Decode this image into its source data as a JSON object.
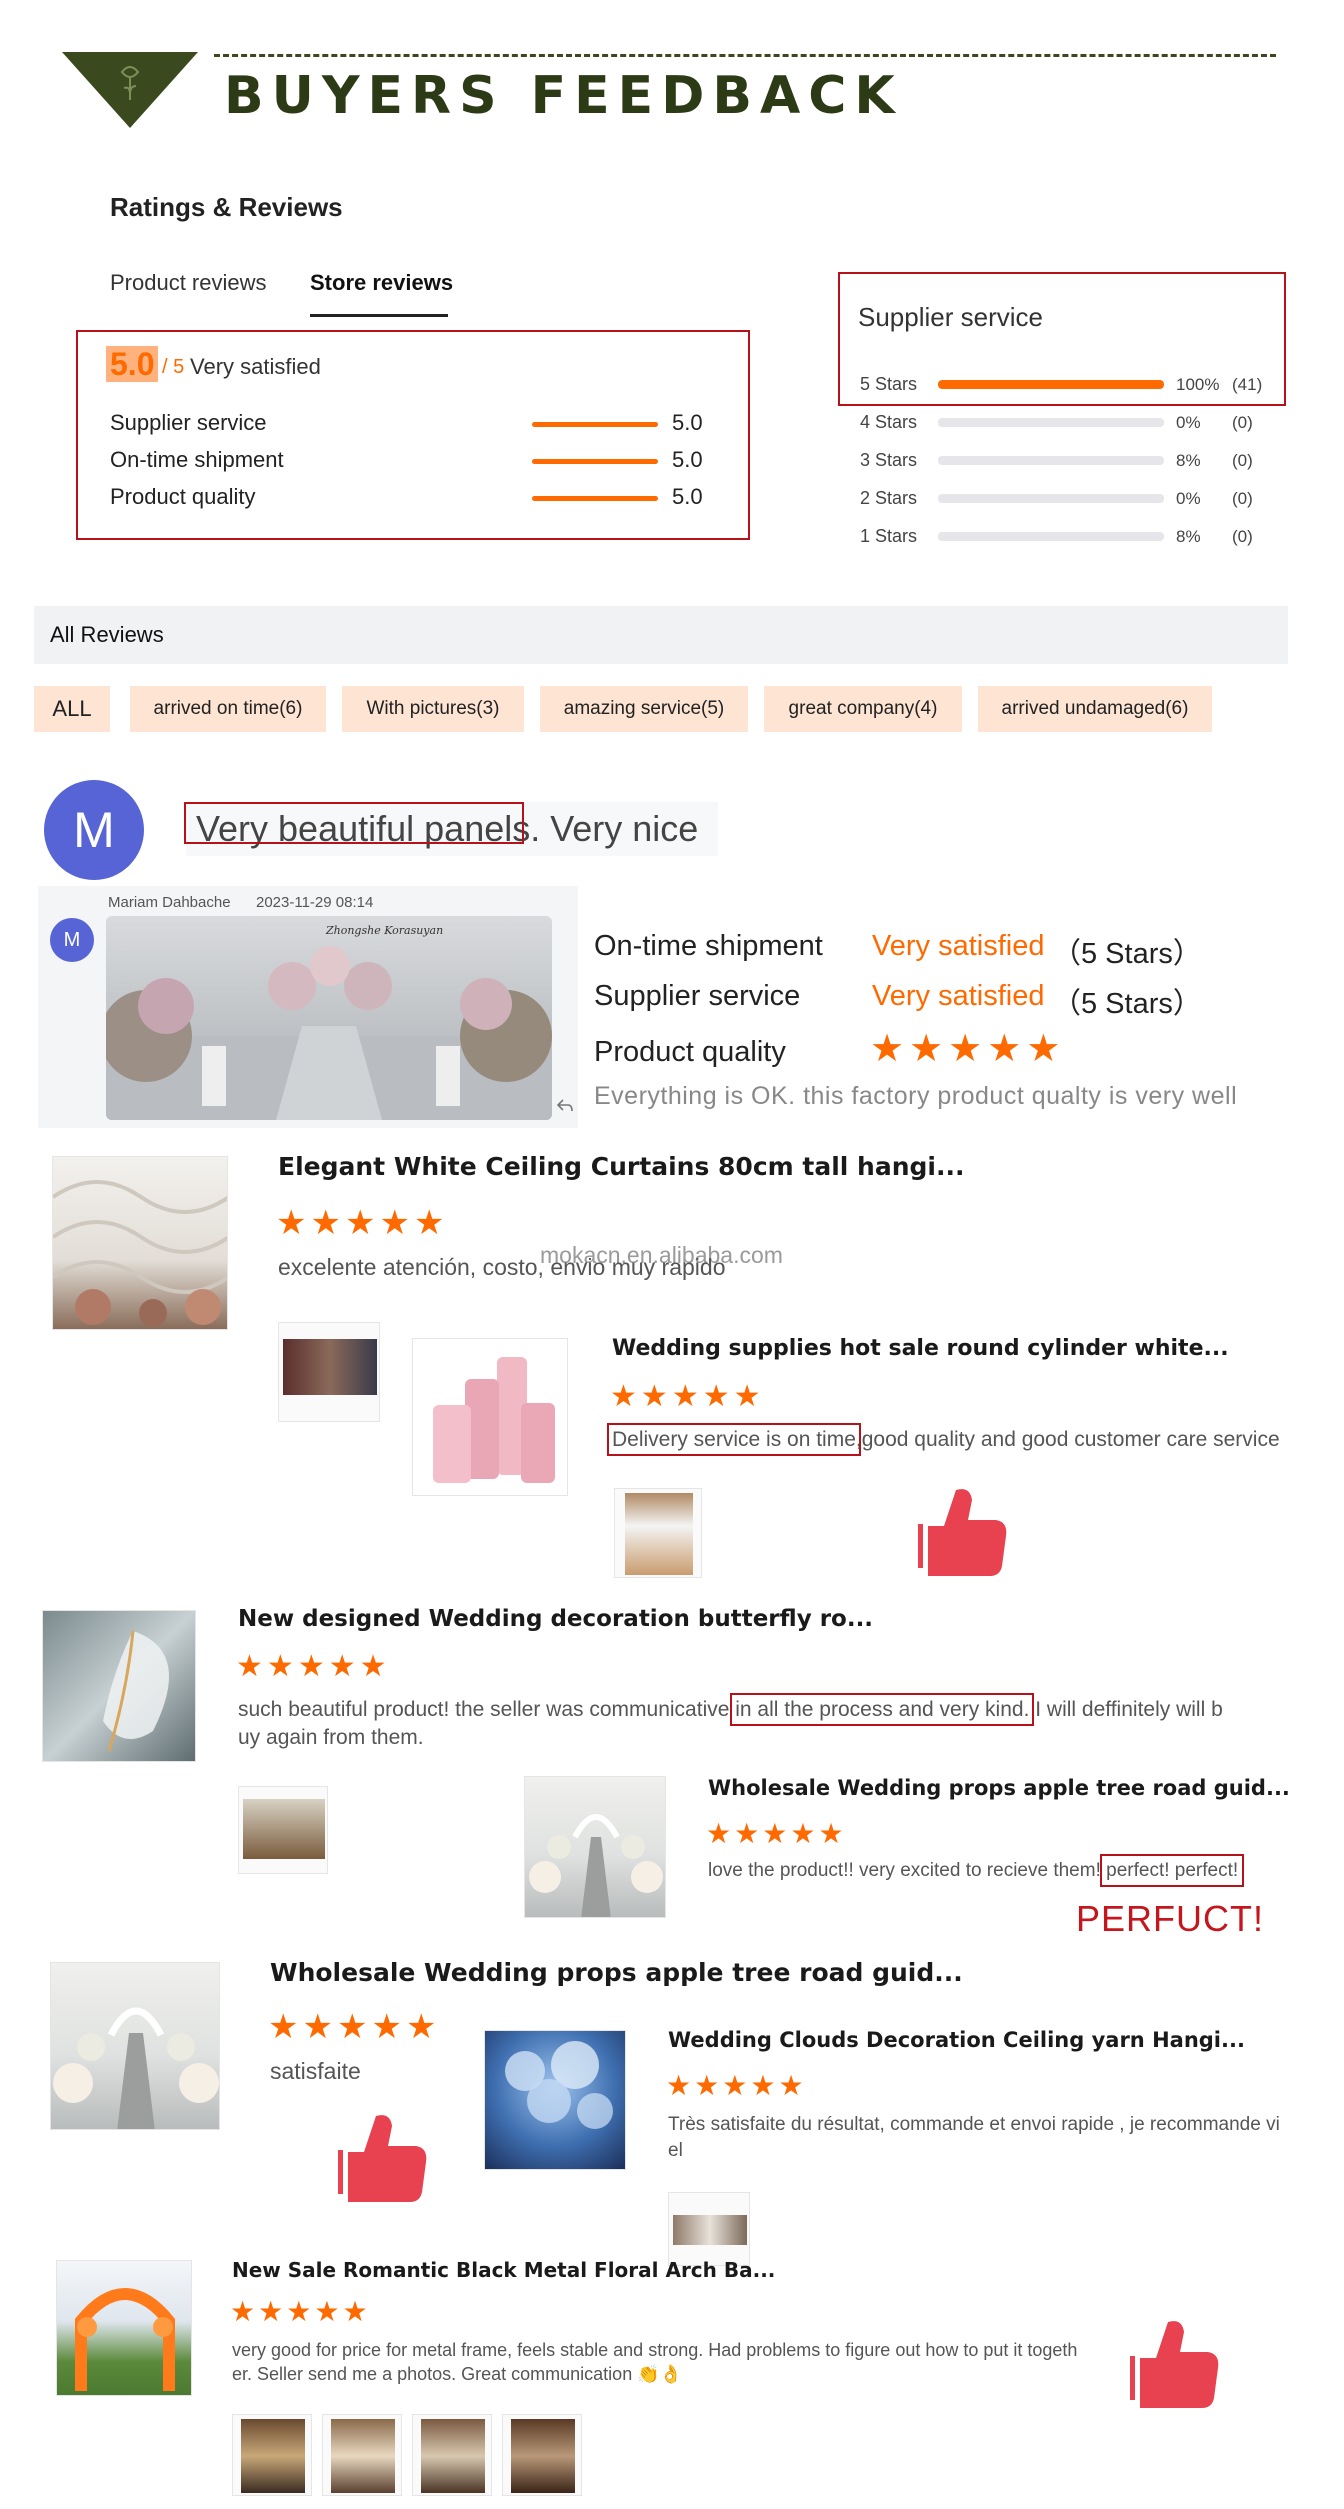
{
  "banner": {
    "title": "BUYERS FEEDBACK"
  },
  "ratings": {
    "heading": "Ratings & Reviews",
    "tabs": [
      "Product reviews",
      "Store reviews"
    ],
    "score": "5.0",
    "score_max": "/ 5",
    "score_label": "Very satisfied",
    "metrics": [
      {
        "label": "Supplier service",
        "value": "5.0",
        "fill": 1.0
      },
      {
        "label": "On-time shipment",
        "value": "5.0",
        "fill": 1.0
      },
      {
        "label": "Product quality",
        "value": "5.0",
        "fill": 1.0
      }
    ],
    "supplier": {
      "title": "Supplier service",
      "rows": [
        {
          "label": "5 Stars",
          "pct": "100%",
          "count": "(41)",
          "fill": 1.0
        },
        {
          "label": "4 Stars",
          "pct": "0%",
          "count": "(0)",
          "fill": 0.0
        },
        {
          "label": "3 Stars",
          "pct": "8%",
          "count": "(0)",
          "fill": 0.0
        },
        {
          "label": "2 Stars",
          "pct": "0%",
          "count": "(0)",
          "fill": 0.0
        },
        {
          "label": "1 Stars",
          "pct": "8%",
          "count": "(0)",
          "fill": 0.0
        }
      ]
    }
  },
  "all_reviews": {
    "heading": "All Reviews",
    "filters": [
      "ALL",
      "arrived on time(6)",
      "With pictures(3)",
      "amazing service(5)",
      "great company(4)",
      "arrived undamaged(6)"
    ]
  },
  "review1": {
    "avatar_letter": "M",
    "headline_highlight": "Very beautiful panels",
    "headline_rest": ". Very nice",
    "reviewer": "Mariam Dahbache",
    "date": "2023-11-29 08:14",
    "mini_avatar": "M",
    "mini_photo_caption": "Zhongshe Korasuyan",
    "ratings": [
      {
        "label": "On-time shipment",
        "value": "Very satisfied",
        "stars": "（5 Stars）"
      },
      {
        "label": "Supplier service",
        "value": "Very satisfied",
        "stars": "（5 Stars）"
      },
      {
        "label": "Product quality",
        "stars_count": 5
      }
    ],
    "comment": "Everything is OK. this factory product qualty is very well"
  },
  "watermark": "mokacn.en.alibaba.com",
  "products": [
    {
      "title": "Elegant White Ceiling Curtains 80cm tall hangi...",
      "stars": 5,
      "comment": "excelente atención, costo, envio muy rapido"
    },
    {
      "title": "Wedding supplies hot sale round cylinder white...",
      "stars": 5,
      "comment_highlight": "Delivery service is on time",
      "comment_rest": ",good quality and good customer care service"
    },
    {
      "title": "New designed Wedding decoration butterfly ro...",
      "stars": 5,
      "comment_a": "such beautiful product! the seller was communicative ",
      "comment_highlight": "in all the process and very kind.",
      "comment_b": " I will deffinitely will b",
      "comment_line2": "uy again from them."
    },
    {
      "title": "Wholesale Wedding props apple tree road guid...",
      "stars": 5,
      "comment_a": "love the product!! very excited to recieve them! ",
      "comment_highlight": "perfect! perfect!"
    },
    {
      "title": "Wholesale Wedding props apple tree road guid...",
      "stars": 5,
      "comment": "satisfaite"
    },
    {
      "title": "Wedding Clouds Decoration Ceiling yarn Hangi...",
      "stars": 5,
      "comment_line1": "Très satisfaite du résultat, commande et envoi rapide , je recommande  vi",
      "comment_line2": "el"
    },
    {
      "title": "New Sale Romantic Black Metal Floral Arch Ba...",
      "stars": 5,
      "comment_line1": "very good for price for metal frame, feels stable and strong. Had problems to figure out how to put it togeth",
      "comment_line2": "er. Seller send me a photos. Great communication 👏👌"
    }
  ],
  "perfuct_label": "PERFUCT!",
  "colors": {
    "accent": "#ff6a00",
    "box_red": "#b5121b",
    "banner_green": "#3a4a1e",
    "thumb_red": "#e8414f",
    "avatar_blue": "#5664d6"
  }
}
